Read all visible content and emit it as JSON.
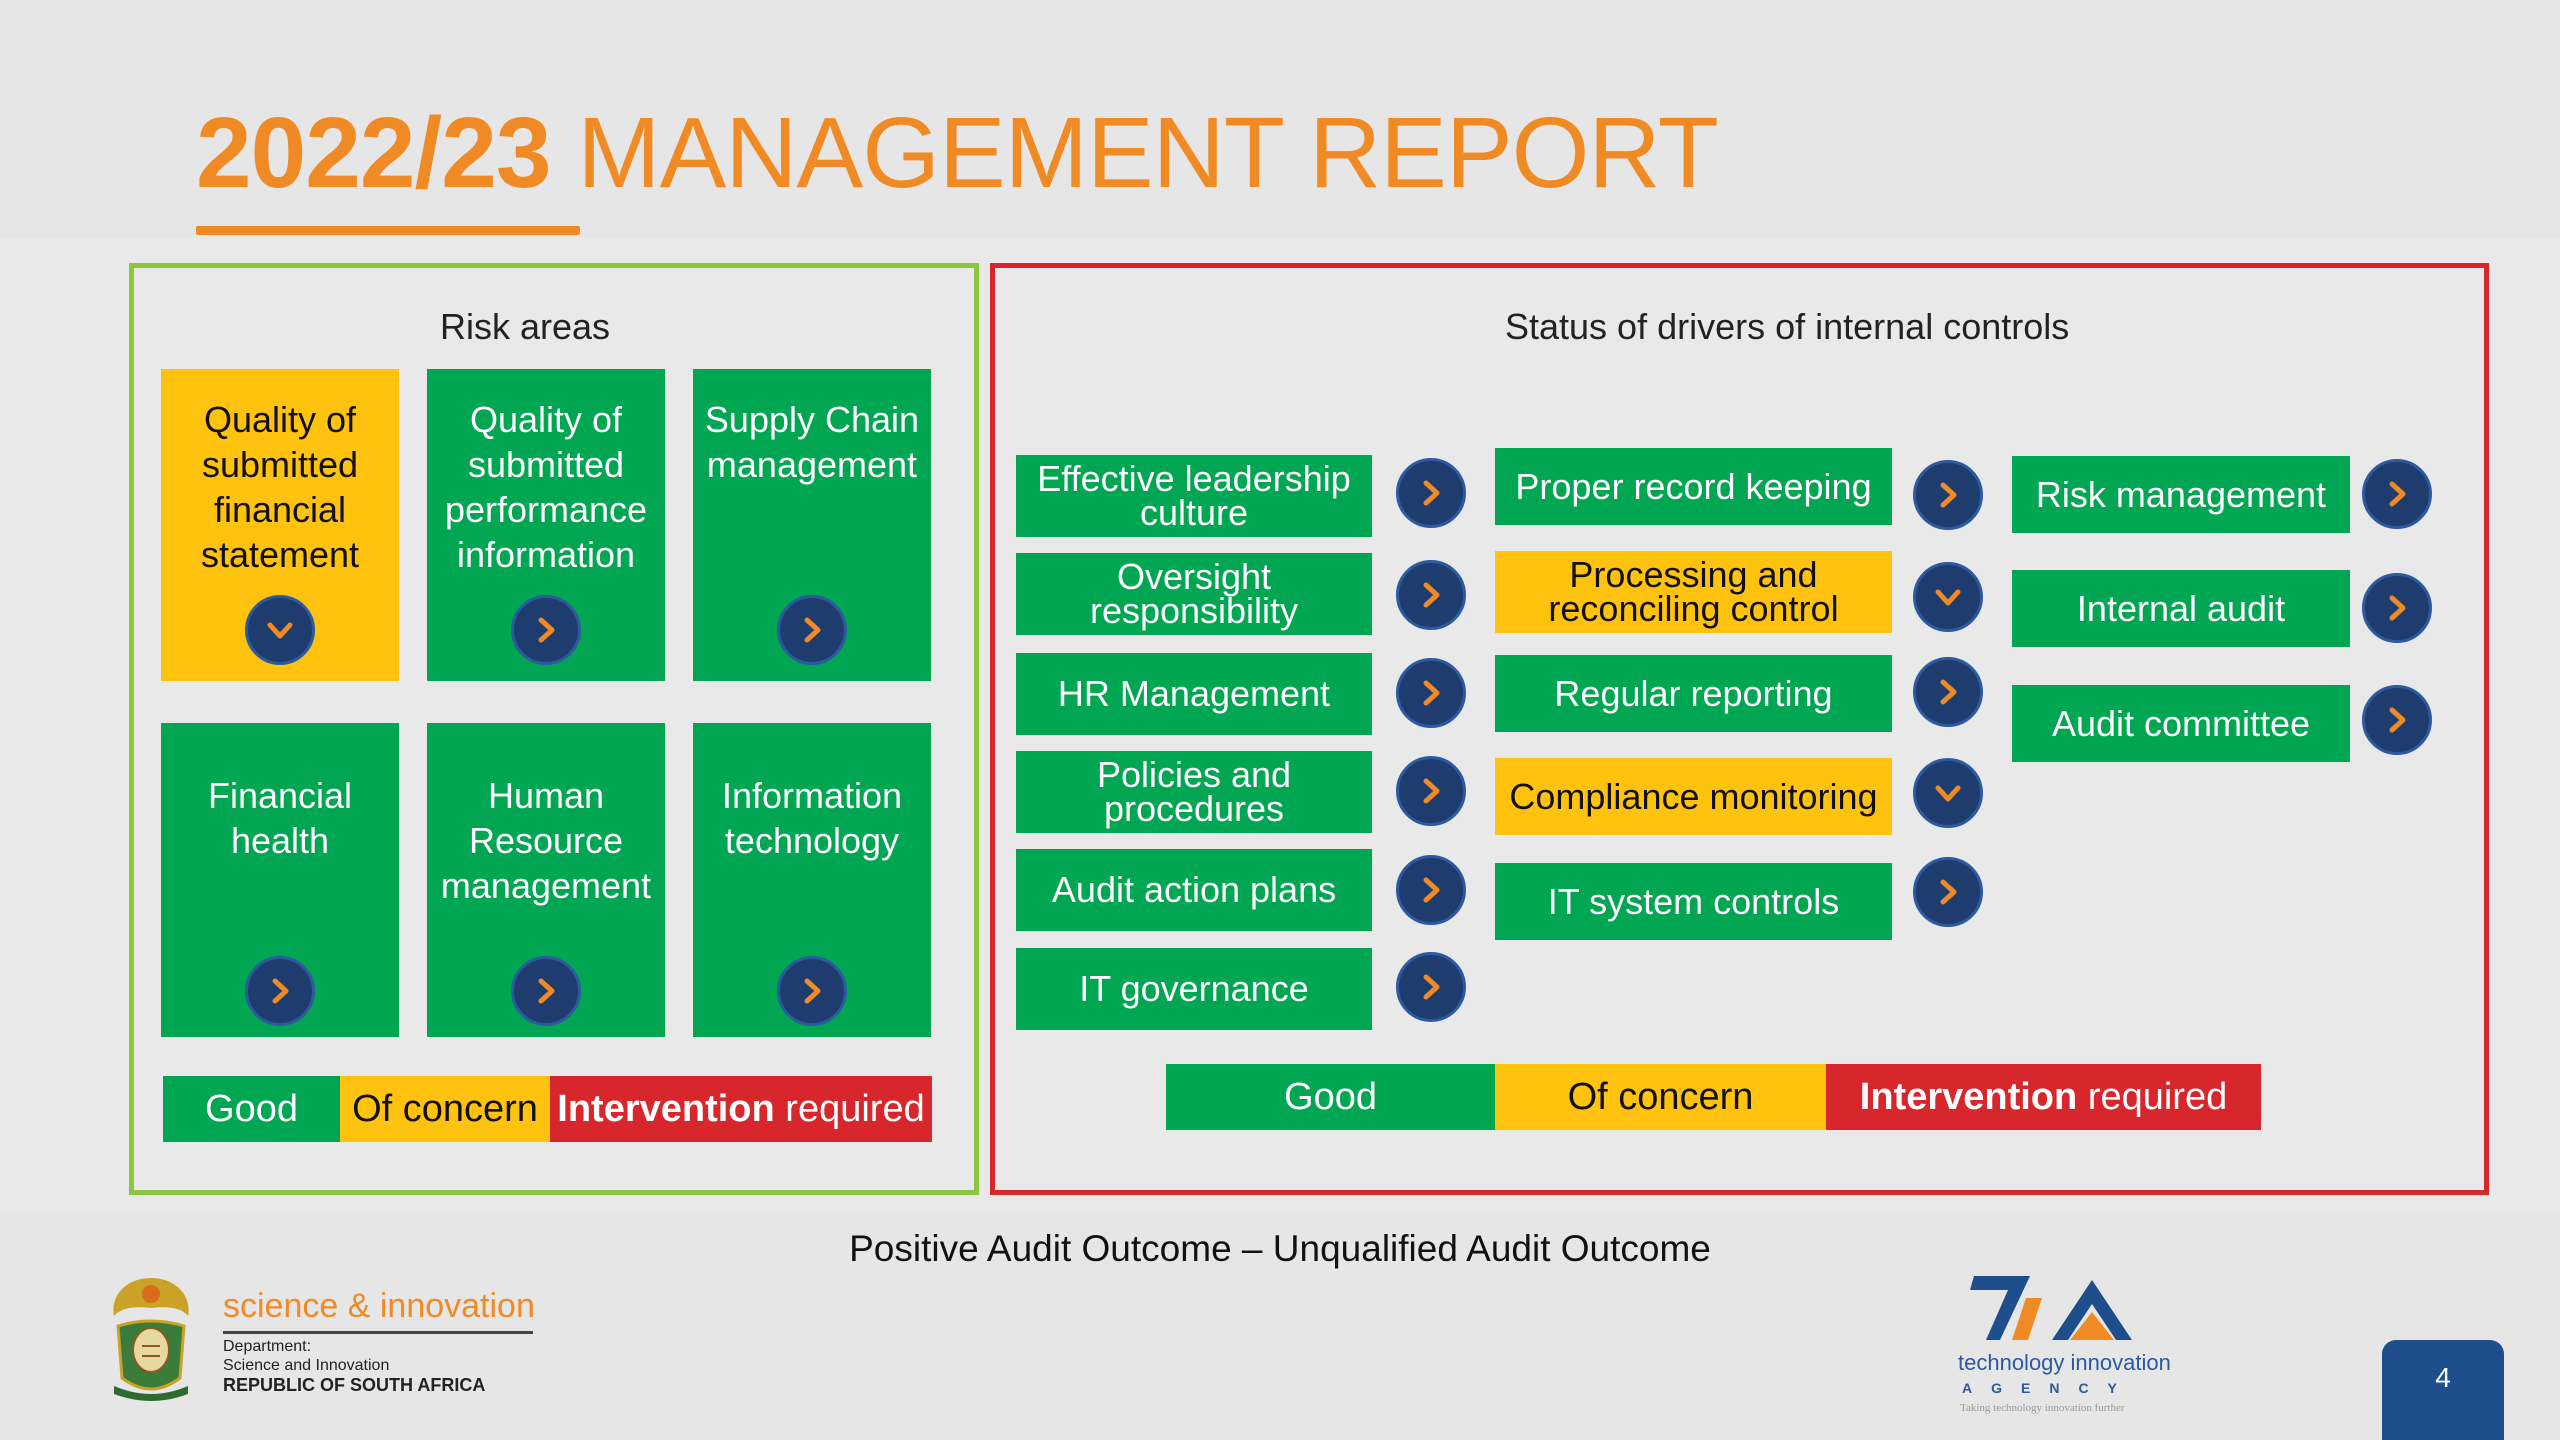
{
  "header": {
    "title_year": "2022/23",
    "title_rest": "MANAGEMENT REPORT"
  },
  "risk_panel": {
    "heading": "Risk areas",
    "tiles": [
      {
        "label": "Quality of submitted financial statement",
        "status": "of-concern",
        "icon": "chevron-down-icon"
      },
      {
        "label": "Quality of submitted performance information",
        "status": "good",
        "icon": "chevron-right-icon"
      },
      {
        "label": "Supply Chain management",
        "status": "good",
        "icon": "chevron-right-icon"
      },
      {
        "label": "Financial health",
        "status": "good",
        "icon": "chevron-right-icon"
      },
      {
        "label": "Human Resource management",
        "status": "good",
        "icon": "chevron-right-icon"
      },
      {
        "label": "Information technology",
        "status": "good",
        "icon": "chevron-right-icon"
      }
    ],
    "legend": {
      "good": "Good",
      "concern": "Of concern",
      "int_bold": "Intervention",
      "int_rest": " required"
    }
  },
  "drivers_panel": {
    "heading": "Status of drivers of internal controls",
    "col1": [
      {
        "label": "Effective leadership culture",
        "status": "good",
        "icon": "chevron-right-icon"
      },
      {
        "label": "Oversight responsibility",
        "status": "good",
        "icon": "chevron-right-icon"
      },
      {
        "label": "HR Management",
        "status": "good",
        "icon": "chevron-right-icon"
      },
      {
        "label": "Policies and procedures",
        "status": "good",
        "icon": "chevron-right-icon"
      },
      {
        "label": "Audit action plans",
        "status": "good",
        "icon": "chevron-right-icon"
      },
      {
        "label": "IT governance",
        "status": "good",
        "icon": "chevron-right-icon"
      }
    ],
    "col2": [
      {
        "label": "Proper record keeping",
        "status": "good",
        "icon": "chevron-right-icon"
      },
      {
        "label": "Processing and reconciling control",
        "status": "of-concern",
        "icon": "chevron-down-icon"
      },
      {
        "label": "Regular reporting",
        "status": "good",
        "icon": "chevron-right-icon"
      },
      {
        "label": "Compliance monitoring",
        "status": "of-concern",
        "icon": "chevron-down-icon"
      },
      {
        "label": "IT system controls",
        "status": "good",
        "icon": "chevron-right-icon"
      }
    ],
    "col3": [
      {
        "label": "Risk management",
        "status": "good",
        "icon": "chevron-right-icon"
      },
      {
        "label": "Internal audit",
        "status": "good",
        "icon": "chevron-right-icon"
      },
      {
        "label": "Audit committee",
        "status": "good",
        "icon": "chevron-right-icon"
      }
    ],
    "legend": {
      "good": "Good",
      "concern": "Of concern",
      "int_bold": "Intervention",
      "int_rest": " required"
    }
  },
  "footer": {
    "caption": "Positive Audit Outcome – Unqualified Audit Outcome",
    "dsi_title": "science & innovation",
    "dsi_line1": "Department:",
    "dsi_line2": "Science and Innovation",
    "dsi_line3": "REPUBLIC OF SOUTH AFRICA",
    "tia_name": "technology innovation",
    "tia_agency": "AGENCY",
    "tia_tagline": "Taking technology innovation further",
    "page_number": "4"
  },
  "colors": {
    "accent_orange": "#f08a24",
    "good_green": "#00a651",
    "concern_yellow": "#ffc20e",
    "intervention_red": "#d7262c",
    "icon_navy": "#1f3c6e",
    "left_border": "#8cc63f",
    "right_border": "#d7262c"
  }
}
